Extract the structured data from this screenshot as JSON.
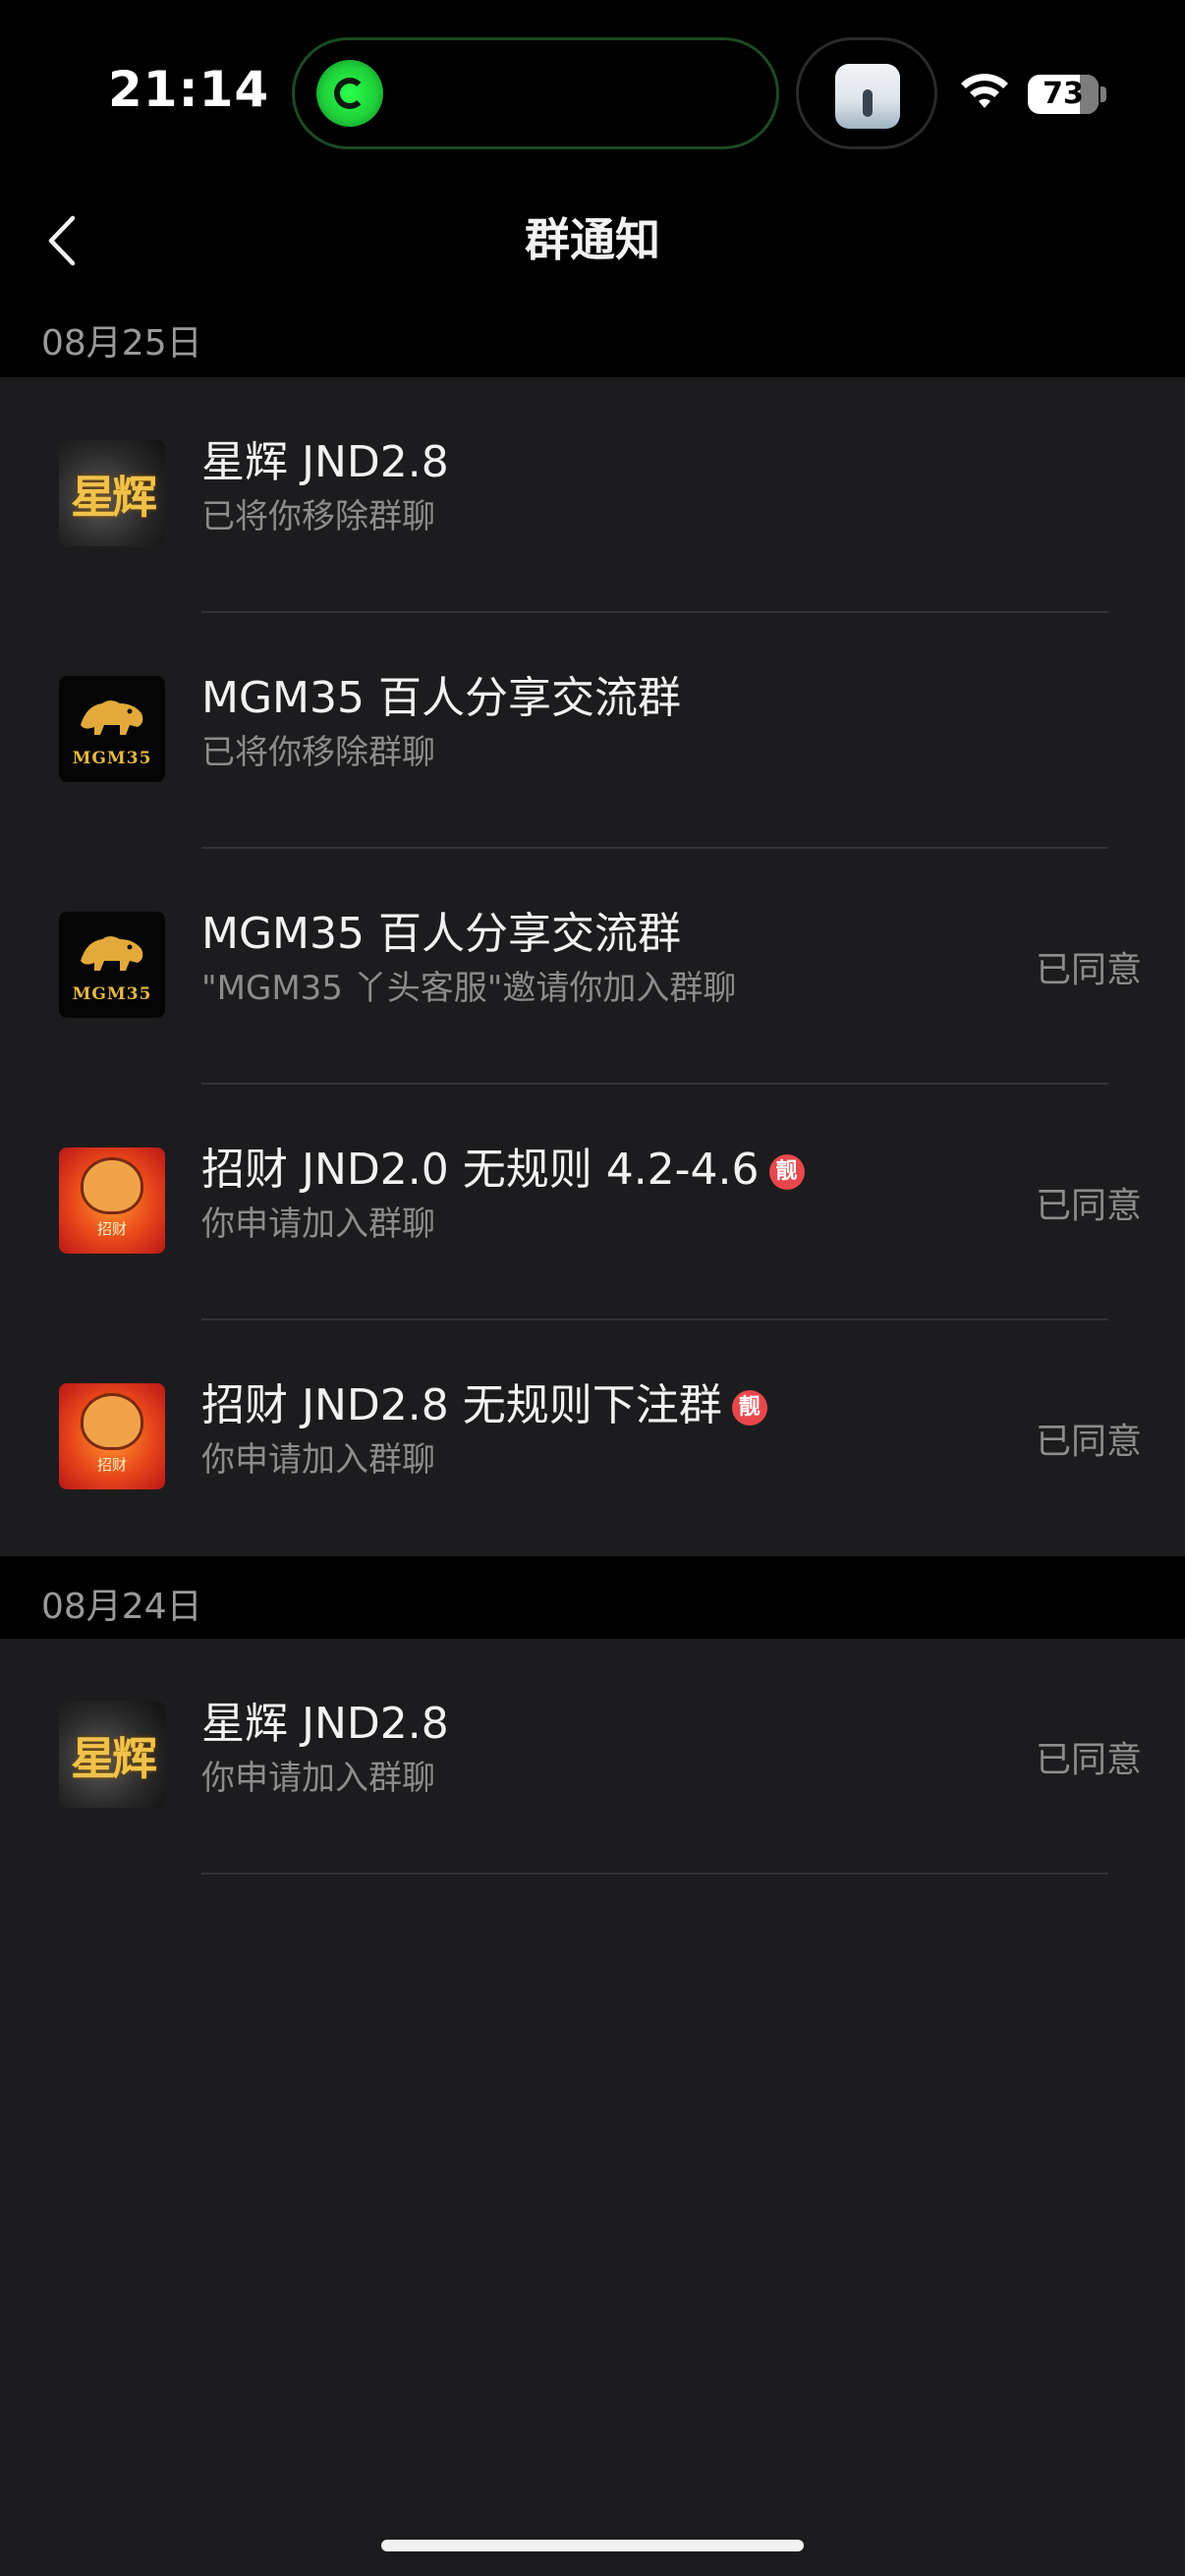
{
  "status_bar": {
    "time": "21:14",
    "battery_level": "73",
    "battery_fraction": 0.73,
    "wifi_icon": "wifi-icon",
    "island_icon": "app-activity-icon"
  },
  "nav": {
    "title": "群通知",
    "back_icon": "chevron-left-icon"
  },
  "sections": [
    {
      "date": "08月25日",
      "items": [
        {
          "title": "星辉 JND2.8",
          "subtitle": "已将你移除群聊",
          "status": "",
          "badge": "",
          "avatar_label": "星辉"
        },
        {
          "title": "MGM35 百人分享交流群",
          "subtitle": "已将你移除群聊",
          "status": "",
          "badge": "",
          "avatar_label": "MGM35"
        },
        {
          "title": "MGM35 百人分享交流群",
          "subtitle": "\"MGM35 丫头客服\"邀请你加入群聊",
          "status": "已同意",
          "badge": "",
          "avatar_label": "MGM35"
        },
        {
          "title": "招财 JND2.0 无规则 4.2-4.6",
          "subtitle": "你申请加入群聊",
          "status": "已同意",
          "badge": "靓",
          "avatar_label": "招财"
        },
        {
          "title": "招财 JND2.8 无规则下注群",
          "subtitle": "你申请加入群聊",
          "status": "已同意",
          "badge": "靓",
          "avatar_label": "招财"
        }
      ]
    },
    {
      "date": "08月24日",
      "items": [
        {
          "title": "星辉 JND2.8",
          "subtitle": "你申请加入群聊",
          "status": "已同意",
          "badge": "",
          "avatar_label": "星辉"
        }
      ]
    }
  ],
  "colors": {
    "background": "#000000",
    "panel": "#1c1c1e",
    "primary_text": "#f2f2f2",
    "secondary_text": "#8c8c8c",
    "badge": "#e8474c"
  }
}
